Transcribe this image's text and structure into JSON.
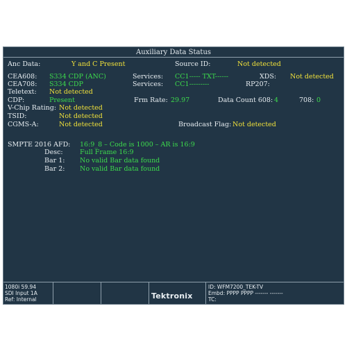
{
  "title": "Auxiliary Data Status",
  "colors": {
    "background": "#213545",
    "label": "#e8eef2",
    "ok": "#3ddc4c",
    "warn": "#f2e23a"
  },
  "anc": {
    "label": "Anc Data:",
    "value": "Y and C Present"
  },
  "source": {
    "label": "Source ID:",
    "value": "Not detected"
  },
  "cea608": {
    "label": "CEA608:",
    "value": "S334 CDP (ANC)"
  },
  "cea708": {
    "label": "CEA708:",
    "value": "S334 CDP"
  },
  "teletext": {
    "label": "Teletext:",
    "value": "Not detected"
  },
  "cdp": {
    "label": "CDP:",
    "value": "Present"
  },
  "vchip": {
    "label": "V-Chip Rating:",
    "value": "Not detected"
  },
  "tsid": {
    "label": "TSID:",
    "value": "Not detected"
  },
  "cgms": {
    "label": "CGMS-A:",
    "value": "Not detected"
  },
  "services1": {
    "label": "Services:",
    "value": "CC1----- TXT------"
  },
  "services2": {
    "label": "Services:",
    "value": "CC1---------"
  },
  "xds": {
    "label": "XDS:",
    "value": "Not detected"
  },
  "rp207": {
    "label": "RP207:",
    "value": ""
  },
  "frm_rate": {
    "label": "Frm Rate:",
    "value": "29.97"
  },
  "data_count": {
    "label": "Data Count 608:",
    "value": "4"
  },
  "count708": {
    "label": "708:",
    "value": "0"
  },
  "broadcast_flag": {
    "label": "Broadcast Flag:",
    "value": "Not detected"
  },
  "afd": {
    "label": "SMPTE 2016 AFD:",
    "value": "16:9_8 – Code is 1000 – AR is 16:9",
    "desc_label": "Desc:",
    "desc_value": "Full Frame 16:9",
    "bar1_label": "Bar 1:",
    "bar1_value": "No valid Bar data found",
    "bar2_label": "Bar 2:",
    "bar2_value": "No valid Bar data found"
  },
  "footer": {
    "format": "1080i 59.94",
    "input": "SDI Input 1A",
    "ref": "Ref: Internal",
    "brand": "Tektronix",
    "id": "ID: WFM7200_TEK-TV",
    "embd": "Embd: PPPP PPPP ------- -------",
    "tc": "TC:"
  }
}
